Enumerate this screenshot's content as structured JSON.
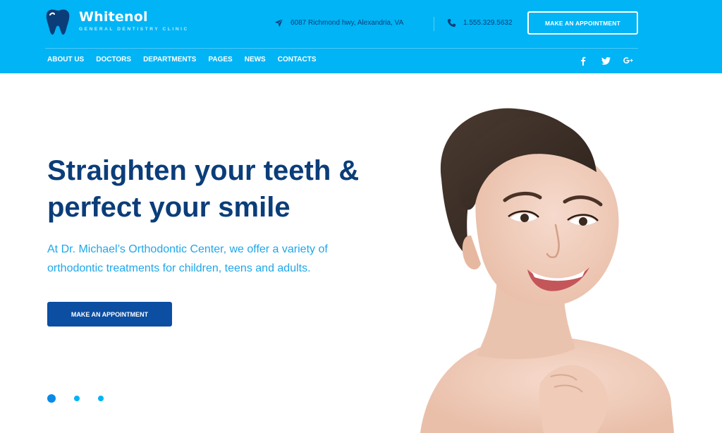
{
  "brand": {
    "name": "Whitenol",
    "tagline": "GENERAL DENTISTRY CLINIC",
    "logo_icon": "tooth-icon"
  },
  "header": {
    "address": "6087 Richmond hwy, Alexandria, VA",
    "address_icon": "paper-plane-icon",
    "phone": "1.555.329.5632",
    "phone_icon": "phone-icon",
    "cta_label": "MAKE AN APPOINTMENT"
  },
  "nav": {
    "items": [
      "ABOUT US",
      "DOCTORS",
      "DEPARTMENTS",
      "PAGES",
      "NEWS",
      "CONTACTS"
    ]
  },
  "social": {
    "icons": [
      "facebook-icon",
      "twitter-icon",
      "google-plus-icon"
    ]
  },
  "hero": {
    "title_line1": "Straighten your teeth &",
    "title_bold": "perfect",
    "title_rest": " your smile",
    "description": "At Dr. Michael’s Orthodontic Center, we offer a variety of orthodontic treatments for children, teens and adults.",
    "cta_label": "MAKE AN APPOINTMENT",
    "slides_total": 3,
    "active_slide": 1
  },
  "colors": {
    "header_bg": "#00b4f5",
    "primary_dark": "#0b3d79",
    "accent": "#1ea7ea",
    "button_bg": "#0b4ea2"
  }
}
